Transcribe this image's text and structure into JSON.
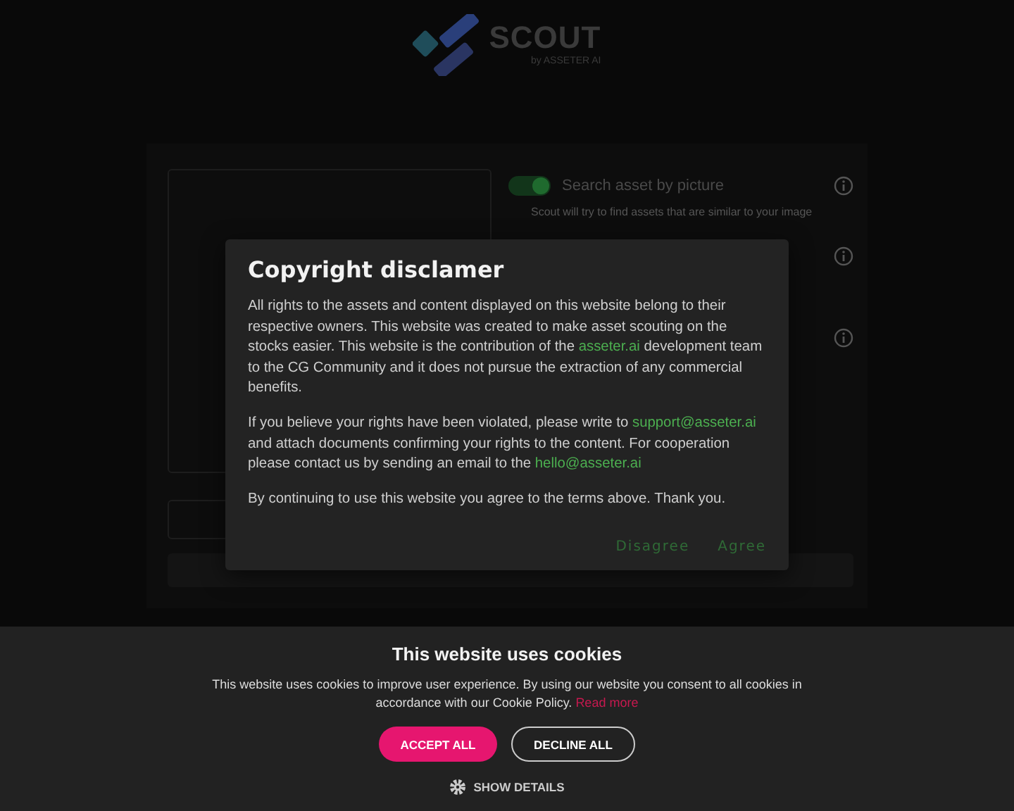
{
  "logo": {
    "name": "SCOUT",
    "byline": "by ASSETER AI"
  },
  "options": [
    {
      "label": "Search asset by picture",
      "description": "Scout will try to find assets that are similar to your image",
      "on": true
    }
  ],
  "dialog": {
    "title": "Copyright disclamer",
    "paragraphs": [
      [
        {
          "text": "All rights to the assets and content displayed on this website belong to their respective owners. This website was created to make asset scouting on the stocks easier. This website is the contribution of the "
        },
        {
          "text": "asseter.ai",
          "link": true
        },
        {
          "text": " development team to the CG Community and it does not pursue the extraction of any commercial benefits."
        }
      ],
      [
        {
          "text": "If you believe your rights have been violated, please write to "
        },
        {
          "text": "support@asseter.ai",
          "link": true
        },
        {
          "text": " and attach documents confirming your rights to the content. For cooperation please contact us by sending an email to the "
        },
        {
          "text": "hello@asseter.ai",
          "link": true
        }
      ],
      [
        {
          "text": "By continuing to use this website you agree to the terms above. Thank you."
        }
      ]
    ],
    "buttons": [
      "Disagree",
      "Agree"
    ]
  },
  "cookies": {
    "title": "This website uses cookies",
    "text": "This website uses cookies to improve user experience. By using our website you consent to all cookies in accordance with our Cookie Policy.",
    "link": "Read more",
    "accept": "ACCEPT ALL",
    "decline": "DECLINE ALL",
    "details": "SHOW DETAILS"
  }
}
